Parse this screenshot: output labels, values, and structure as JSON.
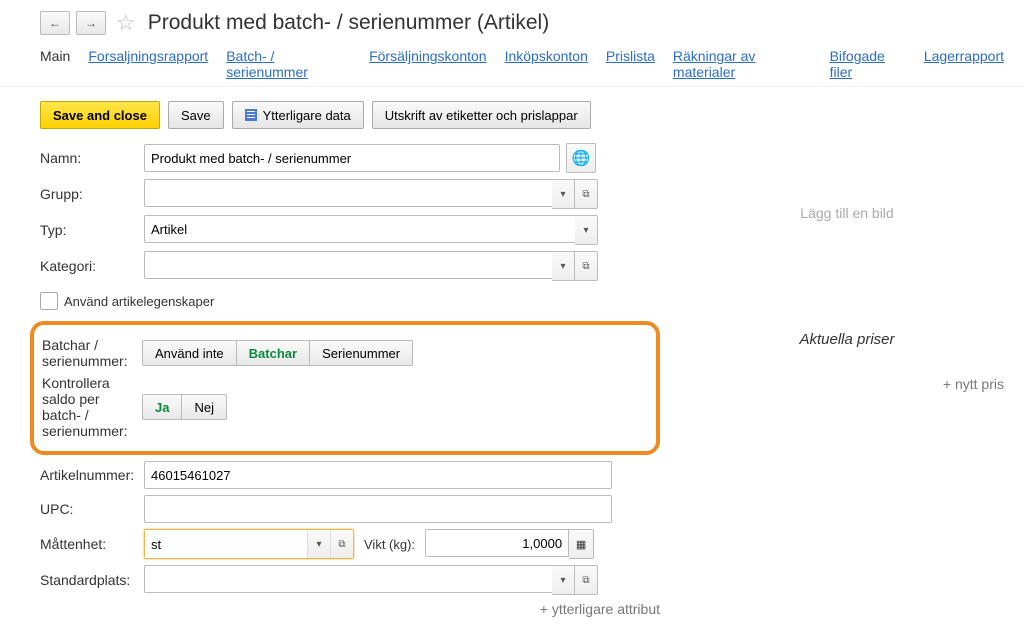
{
  "header": {
    "title": "Produkt med batch- / serienummer (Artikel)"
  },
  "tabs": [
    "Main",
    "Forsaljningsrapport",
    "Batch- / serienummer",
    "Försäljningskonton",
    "Inköpskonton",
    "Prislista",
    "Räkningar av materialer",
    "Bifogade filer",
    "Lagerrapport"
  ],
  "toolbar": {
    "save_close": "Save and close",
    "save": "Save",
    "more_data": "Ytterligare data",
    "labels": "Utskrift av etiketter och prislappar"
  },
  "labels": {
    "name": "Namn:",
    "group": "Grupp:",
    "type": "Typ:",
    "category": "Kategori:",
    "use_props": "Använd artikelegenskaper",
    "batch": "Batchar / serienummer:",
    "control": "Kontrollera saldo per batch- / serienummer:",
    "artnr": "Artikelnummer:",
    "upc": "UPC:",
    "unit": "Måttenhet:",
    "weight": "Vikt (kg):",
    "stdloc": "Standardplats:",
    "more_attr": "+ ytterligare attribut"
  },
  "values": {
    "name": "Produkt med batch- / serienummer",
    "group": "",
    "type": "Artikel",
    "category": "",
    "artnr": "46015461027",
    "upc": "",
    "unit": "st",
    "weight": "1,0000",
    "stdloc": ""
  },
  "seg_batch": [
    "Använd inte",
    "Batchar",
    "Serienummer"
  ],
  "seg_yesno": [
    "Ja",
    "Nej"
  ],
  "right": {
    "add_image": "Lägg till en bild",
    "current_prices": "Aktuella priser",
    "new_price": "+ nytt pris"
  }
}
